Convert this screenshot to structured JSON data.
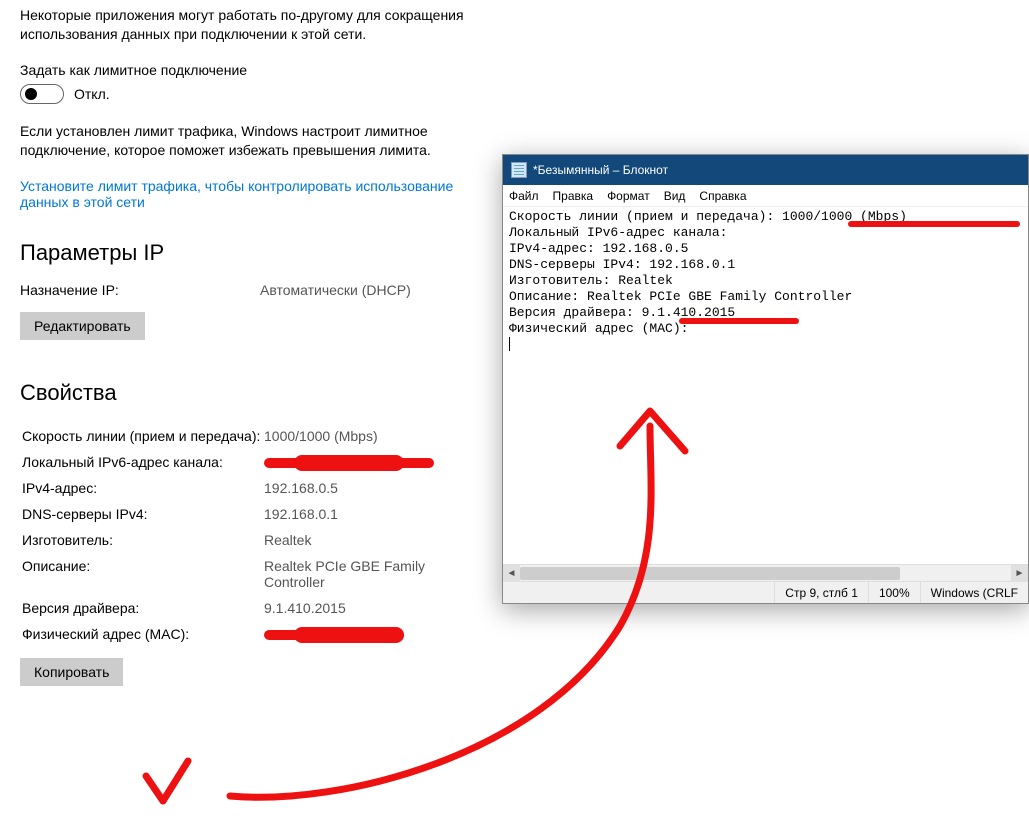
{
  "meteredDesc": "Некоторые приложения могут работать по-другому для сокращения использования данных при подключении к этой сети.",
  "setMeteredLabel": "Задать как лимитное подключение",
  "toggleState": "Откл.",
  "limitNote": "Если установлен лимит трафика, Windows настроит лимитное подключение, которое поможет избежать превышения лимита.",
  "setLimitLink": "Установите лимит трафика, чтобы контролировать использование данных в этой сети",
  "ipParamsHeader": "Параметры IP",
  "ipAssignLabel": "Назначение IP:",
  "ipAssignValue": "Автоматически (DHCP)",
  "editBtn": "Редактировать",
  "propsHeader": "Свойства",
  "props": {
    "speedLabel": "Скорость линии (прием и передача):",
    "speedValue": "1000/1000 (Mbps)",
    "ipv6Label": "Локальный IPv6-адрес канала:",
    "ipv4Label": "IPv4-адрес:",
    "ipv4Value": "192.168.0.5",
    "dnsLabel": "DNS-серверы IPv4:",
    "dnsValue": "192.168.0.1",
    "mfrLabel": "Изготовитель:",
    "mfrValue": "Realtek",
    "descLabel": "Описание:",
    "descValue": "Realtek PCIe GBE Family Controller",
    "drvLabel": "Версия драйвера:",
    "drvValue": "9.1.410.2015",
    "macLabel": "Физический адрес (MAC):"
  },
  "copyBtn": "Копировать",
  "notepad": {
    "title": "*Безымянный – Блокнот",
    "menu": {
      "file": "Файл",
      "edit": "Правка",
      "format": "Формат",
      "view": "Вид",
      "help": "Справка"
    },
    "lines": {
      "l1": "Скорость линии (прием и передача):\t1000/1000 (Mbps)",
      "l2": "Локальный IPv6-адрес канала:",
      "l3": "IPv4-адрес:\t\t192.168.0.5",
      "l4": "DNS-серверы IPv4:\t\t192.168.0.1",
      "l5": "Изготовитель:\t\tRealtek",
      "l6": "Описание:\t\tRealtek PCIe GBE Family Controller",
      "l7": "Версия драйвера:\t9.1.410.2015",
      "l8": "Физический адрес (MAC):"
    },
    "status": {
      "pos": "Стр 9, стлб 1",
      "zoom": "100%",
      "encoding": "Windows (CRLF"
    }
  }
}
